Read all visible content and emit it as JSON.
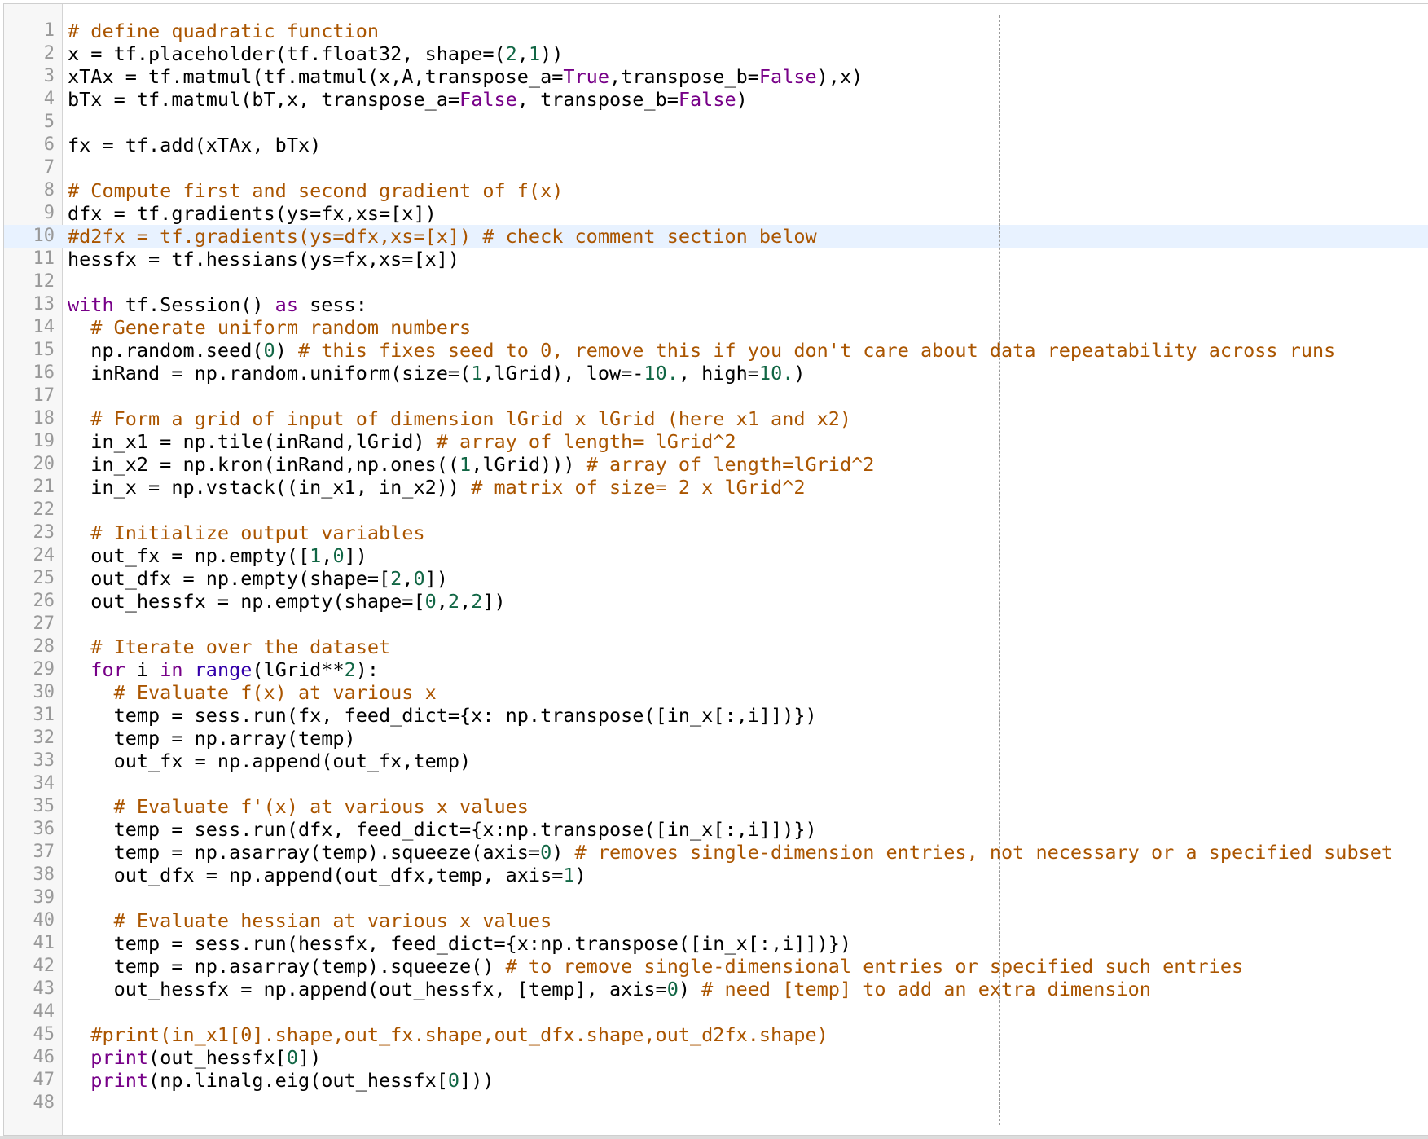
{
  "editor": {
    "active_line": 10,
    "lines": [
      {
        "n": "1",
        "tokens": [
          {
            "t": "# define quadratic function",
            "c": "cm"
          }
        ]
      },
      {
        "n": "2",
        "tokens": [
          {
            "t": "x = tf.placeholder(tf.float32, shape=("
          },
          {
            "t": "2",
            "c": "num"
          },
          {
            "t": ","
          },
          {
            "t": "1",
            "c": "num"
          },
          {
            "t": "))"
          }
        ]
      },
      {
        "n": "3",
        "tokens": [
          {
            "t": "xTAx = tf.matmul(tf.matmul(x,A,transpose_a="
          },
          {
            "t": "True",
            "c": "kw"
          },
          {
            "t": ",transpose_b="
          },
          {
            "t": "False",
            "c": "kw"
          },
          {
            "t": "),x)"
          }
        ]
      },
      {
        "n": "4",
        "tokens": [
          {
            "t": "bTx = tf.matmul(bT,x, transpose_a="
          },
          {
            "t": "False",
            "c": "kw"
          },
          {
            "t": ", transpose_b="
          },
          {
            "t": "False",
            "c": "kw"
          },
          {
            "t": ")"
          }
        ]
      },
      {
        "n": "5",
        "tokens": []
      },
      {
        "n": "6",
        "tokens": [
          {
            "t": "fx = tf.add(xTAx, bTx)"
          }
        ]
      },
      {
        "n": "7",
        "tokens": []
      },
      {
        "n": "8",
        "tokens": [
          {
            "t": "# Compute first and second gradient of f(x)",
            "c": "cm"
          }
        ]
      },
      {
        "n": "9",
        "tokens": [
          {
            "t": "dfx = tf.gradients(ys=fx,xs=[x])"
          }
        ]
      },
      {
        "n": "10",
        "tokens": [
          {
            "t": "#d2fx = tf.gradients(ys=dfx,xs=[x]) # check comment section below",
            "c": "cm"
          }
        ]
      },
      {
        "n": "11",
        "tokens": [
          {
            "t": "hessfx = tf.hessians(ys=fx,xs=[x])"
          }
        ]
      },
      {
        "n": "12",
        "tokens": []
      },
      {
        "n": "13",
        "tokens": [
          {
            "t": "with",
            "c": "kw"
          },
          {
            "t": " tf.Session() "
          },
          {
            "t": "as",
            "c": "kw"
          },
          {
            "t": " sess:"
          }
        ]
      },
      {
        "n": "14",
        "tokens": [
          {
            "t": "  "
          },
          {
            "t": "# Generate uniform random numbers",
            "c": "cm"
          }
        ]
      },
      {
        "n": "15",
        "tokens": [
          {
            "t": "  np.random.seed("
          },
          {
            "t": "0",
            "c": "num"
          },
          {
            "t": ") "
          },
          {
            "t": "# this fixes seed to 0, remove this if you don't care about data repeatability across runs",
            "c": "cm"
          }
        ]
      },
      {
        "n": "16",
        "tokens": [
          {
            "t": "  inRand = np.random.uniform(size=("
          },
          {
            "t": "1",
            "c": "num"
          },
          {
            "t": ",lGrid), low=-"
          },
          {
            "t": "10.",
            "c": "num"
          },
          {
            "t": ", high="
          },
          {
            "t": "10.",
            "c": "num"
          },
          {
            "t": ")"
          }
        ]
      },
      {
        "n": "17",
        "tokens": []
      },
      {
        "n": "18",
        "tokens": [
          {
            "t": "  "
          },
          {
            "t": "# Form a grid of input of dimension lGrid x lGrid (here x1 and x2)",
            "c": "cm"
          }
        ]
      },
      {
        "n": "19",
        "tokens": [
          {
            "t": "  in_x1 = np.tile(inRand,lGrid) "
          },
          {
            "t": "# array of length= lGrid^2",
            "c": "cm"
          }
        ]
      },
      {
        "n": "20",
        "tokens": [
          {
            "t": "  in_x2 = np.kron(inRand,np.ones(("
          },
          {
            "t": "1",
            "c": "num"
          },
          {
            "t": ",lGrid))) "
          },
          {
            "t": "# array of length=lGrid^2",
            "c": "cm"
          }
        ]
      },
      {
        "n": "21",
        "tokens": [
          {
            "t": "  in_x = np.vstack((in_x1, in_x2)) "
          },
          {
            "t": "# matrix of size= 2 x lGrid^2",
            "c": "cm"
          }
        ]
      },
      {
        "n": "22",
        "tokens": []
      },
      {
        "n": "23",
        "tokens": [
          {
            "t": "  "
          },
          {
            "t": "# Initialize output variables",
            "c": "cm"
          }
        ]
      },
      {
        "n": "24",
        "tokens": [
          {
            "t": "  out_fx = np.empty(["
          },
          {
            "t": "1",
            "c": "num"
          },
          {
            "t": ","
          },
          {
            "t": "0",
            "c": "num"
          },
          {
            "t": "])"
          }
        ]
      },
      {
        "n": "25",
        "tokens": [
          {
            "t": "  out_dfx = np.empty(shape=["
          },
          {
            "t": "2",
            "c": "num"
          },
          {
            "t": ","
          },
          {
            "t": "0",
            "c": "num"
          },
          {
            "t": "])"
          }
        ]
      },
      {
        "n": "26",
        "tokens": [
          {
            "t": "  out_hessfx = np.empty(shape=["
          },
          {
            "t": "0",
            "c": "num"
          },
          {
            "t": ","
          },
          {
            "t": "2",
            "c": "num"
          },
          {
            "t": ","
          },
          {
            "t": "2",
            "c": "num"
          },
          {
            "t": "])"
          }
        ]
      },
      {
        "n": "27",
        "tokens": []
      },
      {
        "n": "28",
        "tokens": [
          {
            "t": "  "
          },
          {
            "t": "# Iterate over the dataset",
            "c": "cm"
          }
        ]
      },
      {
        "n": "29",
        "tokens": [
          {
            "t": "  "
          },
          {
            "t": "for",
            "c": "kw"
          },
          {
            "t": " i "
          },
          {
            "t": "in",
            "c": "kw"
          },
          {
            "t": " "
          },
          {
            "t": "range",
            "c": "bi"
          },
          {
            "t": "(lGrid**"
          },
          {
            "t": "2",
            "c": "num"
          },
          {
            "t": "):"
          }
        ]
      },
      {
        "n": "30",
        "tokens": [
          {
            "t": "    "
          },
          {
            "t": "# Evaluate f(x) at various x",
            "c": "cm"
          }
        ]
      },
      {
        "n": "31",
        "tokens": [
          {
            "t": "    temp = sess.run(fx, feed_dict={x: np.transpose([in_x[:,i]])})"
          }
        ]
      },
      {
        "n": "32",
        "tokens": [
          {
            "t": "    temp = np.array(temp)"
          }
        ]
      },
      {
        "n": "33",
        "tokens": [
          {
            "t": "    out_fx = np.append(out_fx,temp)"
          }
        ]
      },
      {
        "n": "34",
        "tokens": []
      },
      {
        "n": "35",
        "tokens": [
          {
            "t": "    "
          },
          {
            "t": "# Evaluate f'(x) at various x values",
            "c": "cm"
          }
        ]
      },
      {
        "n": "36",
        "tokens": [
          {
            "t": "    temp = sess.run(dfx, feed_dict={x:np.transpose([in_x[:,i]])})"
          }
        ]
      },
      {
        "n": "37",
        "tokens": [
          {
            "t": "    temp = np.asarray(temp).squeeze(axis="
          },
          {
            "t": "0",
            "c": "num"
          },
          {
            "t": ") "
          },
          {
            "t": "# removes single-dimension entries, not necessary or a specified subset",
            "c": "cm"
          }
        ]
      },
      {
        "n": "38",
        "tokens": [
          {
            "t": "    out_dfx = np.append(out_dfx,temp, axis="
          },
          {
            "t": "1",
            "c": "num"
          },
          {
            "t": ")"
          }
        ]
      },
      {
        "n": "39",
        "tokens": []
      },
      {
        "n": "40",
        "tokens": [
          {
            "t": "    "
          },
          {
            "t": "# Evaluate hessian at various x values",
            "c": "cm"
          }
        ]
      },
      {
        "n": "41",
        "tokens": [
          {
            "t": "    temp = sess.run(hessfx, feed_dict={x:np.transpose([in_x[:,i]])})"
          }
        ]
      },
      {
        "n": "42",
        "tokens": [
          {
            "t": "    temp = np.asarray(temp).squeeze() "
          },
          {
            "t": "# to remove single-dimensional entries or specified such entries",
            "c": "cm"
          }
        ]
      },
      {
        "n": "43",
        "tokens": [
          {
            "t": "    out_hessfx = np.append(out_hessfx, [temp], axis="
          },
          {
            "t": "0",
            "c": "num"
          },
          {
            "t": ") "
          },
          {
            "t": "# need [temp] to add an extra dimension",
            "c": "cm"
          }
        ]
      },
      {
        "n": "44",
        "tokens": []
      },
      {
        "n": "45",
        "tokens": [
          {
            "t": "  "
          },
          {
            "t": "#print(in_x1[0].shape,out_fx.shape,out_dfx.shape,out_d2fx.shape)",
            "c": "cm"
          }
        ]
      },
      {
        "n": "46",
        "tokens": [
          {
            "t": "  "
          },
          {
            "t": "print",
            "c": "kw"
          },
          {
            "t": "(out_hessfx["
          },
          {
            "t": "0",
            "c": "num"
          },
          {
            "t": "])"
          }
        ]
      },
      {
        "n": "47",
        "tokens": [
          {
            "t": "  "
          },
          {
            "t": "print",
            "c": "kw"
          },
          {
            "t": "(np.linalg.eig(out_hessfx["
          },
          {
            "t": "0",
            "c": "num"
          },
          {
            "t": "]))"
          }
        ]
      },
      {
        "n": "48",
        "tokens": []
      }
    ]
  }
}
